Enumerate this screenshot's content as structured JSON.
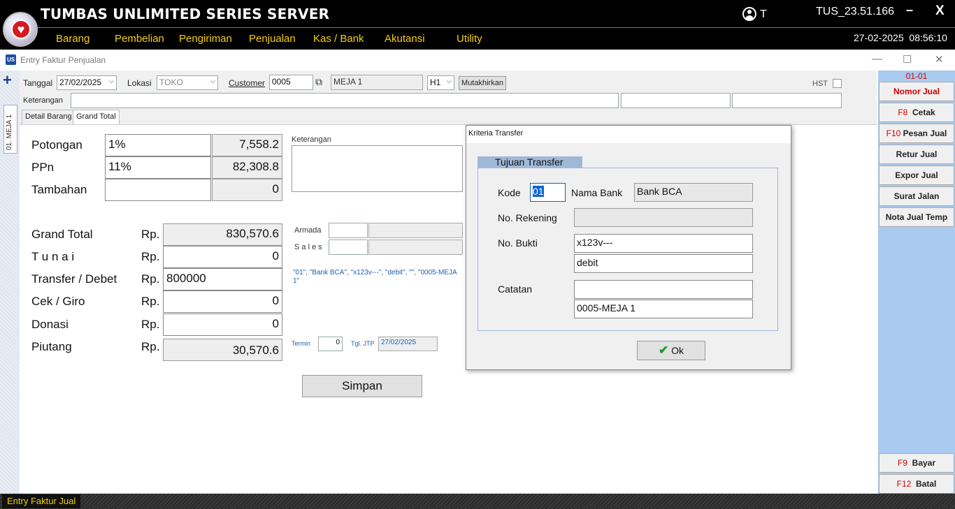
{
  "topbar": {
    "title": "TUMBAS UNLIMITED SERIES SERVER",
    "user": "T",
    "version": "TUS_23.51.166",
    "minimize": "–",
    "close": "X",
    "date": "27-02-2025",
    "time": "08:56:10",
    "menu": [
      "Barang",
      "Pembelian",
      "Pengiriman",
      "Penjualan",
      "Kas / Bank",
      "Akutansi",
      "Utility"
    ]
  },
  "window": {
    "icon": "US",
    "title": "Entry Faktur Penjualan"
  },
  "form": {
    "side_tab": "01. MEJA 1",
    "tanggal_label": "Tanggal",
    "tanggal_value": "27/02/2025",
    "lokasi_label": "Lokasi",
    "lokasi_value": "TOKO",
    "customer_label": "Customer",
    "customer_code": "0005",
    "customer_name": "MEJA 1",
    "harga_level": "H1",
    "mutakhirkan": "Mutakhirkan",
    "hst_label": "HST",
    "keterangan_label": "Keterangan",
    "tabs": [
      "Detail Barang",
      "Grand Total"
    ]
  },
  "totals": {
    "potongan_label": "Potongan",
    "potongan_pct": "1%",
    "potongan_value": "7,558.2",
    "ppn_label": "PPn",
    "ppn_pct": "11%",
    "ppn_value": "82,308.8",
    "tambahan_label": "Tambahan",
    "tambahan_value": "0",
    "keterangan_label": "Keterangan",
    "rp": "Rp.",
    "grand_total_label": "Grand Total",
    "grand_total_value": "830,570.6",
    "tunai_label": "T u n a i",
    "tunai_value": "0",
    "transfer_label": "Transfer / Debet",
    "transfer_value": "800000",
    "cek_label": "Cek / Giro",
    "cek_value": "0",
    "donasi_label": "Donasi",
    "donasi_value": "0",
    "piutang_label": "Piutang",
    "piutang_value": "30,570.6",
    "armada_label": "Armada",
    "sales_label": "S a l e s",
    "summary_text": "\"01\", \"Bank BCA\", \"x123v---\", \"debit\", \"\", \"0005-MEJA 1\"",
    "termin_label": "Termin",
    "termin_value": "0",
    "tgl_jtp_label": "Tgl. JTP",
    "tgl_jtp_value": "27/02/2025",
    "simpan": "Simpan"
  },
  "right_panel": {
    "code": "01-01",
    "buttons": [
      {
        "key": "",
        "label": "Nomor Jual"
      },
      {
        "key": "F8",
        "label": "Cetak"
      },
      {
        "key": "F10",
        "label": "Pesan Jual"
      },
      {
        "key": "",
        "label": "Retur Jual"
      },
      {
        "key": "",
        "label": "Expor Jual"
      },
      {
        "key": "",
        "label": "Surat Jalan"
      },
      {
        "key": "",
        "label": "Nota Jual Temp"
      },
      {
        "key": "F9",
        "label": "Bayar"
      },
      {
        "key": "F12",
        "label": "Batal"
      }
    ]
  },
  "status_bar": {
    "label": "Entry Faktur Jual"
  },
  "dialog": {
    "title": "Kriteria Transfer",
    "group": "Tujuan Transfer",
    "kode_label": "Kode",
    "kode_value": "01",
    "nama_bank_label": "Nama Bank",
    "nama_bank_value": "Bank BCA",
    "rekening_label": "No. Rekening",
    "rekening_value": "",
    "bukti_label": "No. Bukti",
    "bukti_value": "x123v---",
    "bukti_value2": "debit",
    "catatan_label": "Catatan",
    "catatan_value": "",
    "catatan_value2": "0005-MEJA 1",
    "ok": "Ok"
  }
}
